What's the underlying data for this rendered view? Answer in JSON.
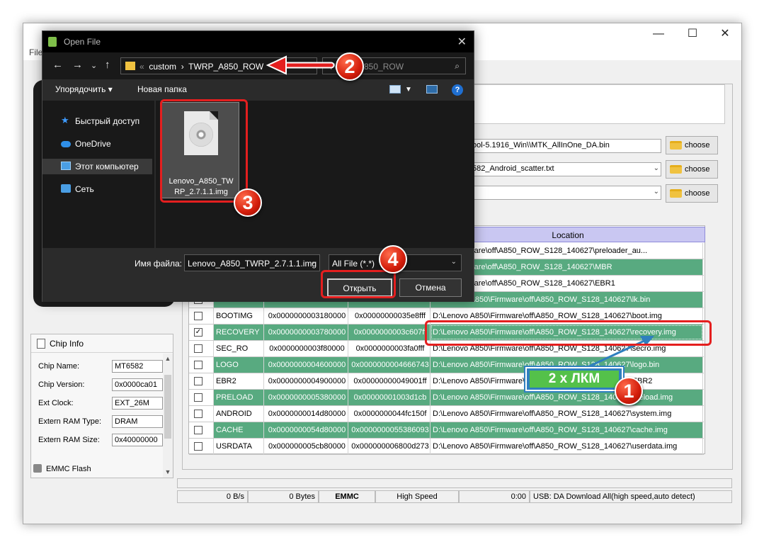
{
  "app": {
    "menu_first": "File",
    "win_min": "—",
    "win_max": "☐",
    "win_close": "✕",
    "path_inputs": [
      "ool-5.1916_Win\\\\MTK_AllInOne_DA.bin",
      "582_Android_scatter.txt",
      ""
    ],
    "choose_label": "choose",
    "table": {
      "location_header": "Location",
      "rows": [
        {
          "name": "",
          "begin": "",
          "end": "",
          "location": "A850\\Firmware\\off\\A850_ROW_S128_140627\\preloader_au...",
          "checked": false,
          "hl": false
        },
        {
          "name": "",
          "begin": "",
          "end": "",
          "location": "A850\\Firmware\\off\\A850_ROW_S128_140627\\MBR",
          "checked": false,
          "hl": true
        },
        {
          "name": "",
          "begin": "",
          "end": "",
          "location": "A850\\Firmware\\off\\A850_ROW_S128_140627\\EBR1",
          "checked": false,
          "hl": false
        },
        {
          "name": "UBOOT",
          "begin": "",
          "end": "",
          "location": "D:\\Lenovo A850\\Firmware\\off\\A850_ROW_S128_140627\\lk.bin",
          "checked": false,
          "hl": true
        },
        {
          "name": "BOOTIMG",
          "begin": "0x0000000003180000",
          "end": "0x00000000035e8fff",
          "location": "D:\\Lenovo A850\\Firmware\\off\\A850_ROW_S128_140627\\boot.img",
          "checked": false,
          "hl": false
        },
        {
          "name": "RECOVERY",
          "begin": "0x0000000003780000",
          "end": "0x0000000003c607ff",
          "location": "D:\\Lenovo A850\\Firmware\\off\\A850_ROW_S128_140627\\recovery.img",
          "checked": true,
          "hl": true
        },
        {
          "name": "SEC_RO",
          "begin": "0x0000000003f80000",
          "end": "0x0000000003fa0fff",
          "location": "D:\\Lenovo A850\\Firmware\\off\\A850_ROW_S128_140627\\secro.img",
          "checked": false,
          "hl": false
        },
        {
          "name": "LOGO",
          "begin": "0x0000000004600000",
          "end": "0x0000000004666743",
          "location": "D:\\Lenovo A850\\Firmware\\off\\A850_ROW_S128_140627\\logo.bin",
          "checked": false,
          "hl": true
        },
        {
          "name": "EBR2",
          "begin": "0x0000000004900000",
          "end": "0x00000000049001ff",
          "location": "D:\\Lenovo A850\\Firmware\\off\\A850_ROW_S128_140627\\EBR2",
          "checked": false,
          "hl": false
        },
        {
          "name": "PRELOAD",
          "begin": "0x0000000005380000",
          "end": "0x00000001003d1cb",
          "location": "D:\\Lenovo A850\\Firmware\\off\\A850_ROW_S128_140627\\preload.img",
          "checked": false,
          "hl": true
        },
        {
          "name": "ANDROID",
          "begin": "0x0000000014d80000",
          "end": "0x0000000044fc150f",
          "location": "D:\\Lenovo A850\\Firmware\\off\\A850_ROW_S128_140627\\system.img",
          "checked": false,
          "hl": false
        },
        {
          "name": "CACHE",
          "begin": "0x0000000054d80000",
          "end": "0x0000000055386093",
          "location": "D:\\Lenovo A850\\Firmware\\off\\A850_ROW_S128_140627\\cache.img",
          "checked": false,
          "hl": true
        },
        {
          "name": "USRDATA",
          "begin": "0x000000005cb80000",
          "end": "0x000000006800d273",
          "location": "D:\\Lenovo A850\\Firmware\\off\\A850_ROW_S128_140627\\userdata.img",
          "checked": false,
          "hl": false
        }
      ]
    },
    "chip_info": {
      "title": "Chip Info",
      "rows": [
        {
          "label": "Chip Name:",
          "value": "MT6582"
        },
        {
          "label": "Chip Version:",
          "value": "0x0000ca01"
        },
        {
          "label": "Ext Clock:",
          "value": "EXT_26M"
        },
        {
          "label": "Extern RAM Type:",
          "value": "DRAM"
        },
        {
          "label": "Extern RAM Size:",
          "value": "0x40000000"
        }
      ],
      "emmc_label": "EMMC Flash"
    },
    "status": {
      "speed": "0 B/s",
      "bytes": "0 Bytes",
      "storage": "EMMC",
      "mode": "High Speed",
      "time": "0:00",
      "usb": "USB: DA Download All(high speed,auto detect)"
    }
  },
  "dialog": {
    "title": "Open File",
    "close": "✕",
    "breadcrumb_sep": "«",
    "breadcrumb_1": "custom",
    "breadcrumb_arrow": "›",
    "breadcrumb_2": "TWRP_A850_ROW",
    "search_placeholder": "TWRP_A850_ROW",
    "organize": "Упорядочить ▾",
    "new_folder": "Новая папка",
    "sidebar": [
      "Быстрый доступ",
      "OneDrive",
      "Этот компьютер",
      "Сеть"
    ],
    "file_name_tile": "Lenovo_A850_TWRP_2.7.1.1.img",
    "file_name_line1": "Lenovo_A850_TW",
    "file_name_line2": "RP_2.7.1.1.img",
    "filename_label": "Имя файла:",
    "filename_value": "Lenovo_A850_TWRP_2.7.1.1.img",
    "filetype": "All File (*.*)",
    "open_label": "Открыть",
    "cancel_label": "Отмена"
  },
  "annotations": {
    "badges": [
      "1",
      "2",
      "3",
      "4"
    ],
    "lkm": "2 х ЛКМ"
  }
}
